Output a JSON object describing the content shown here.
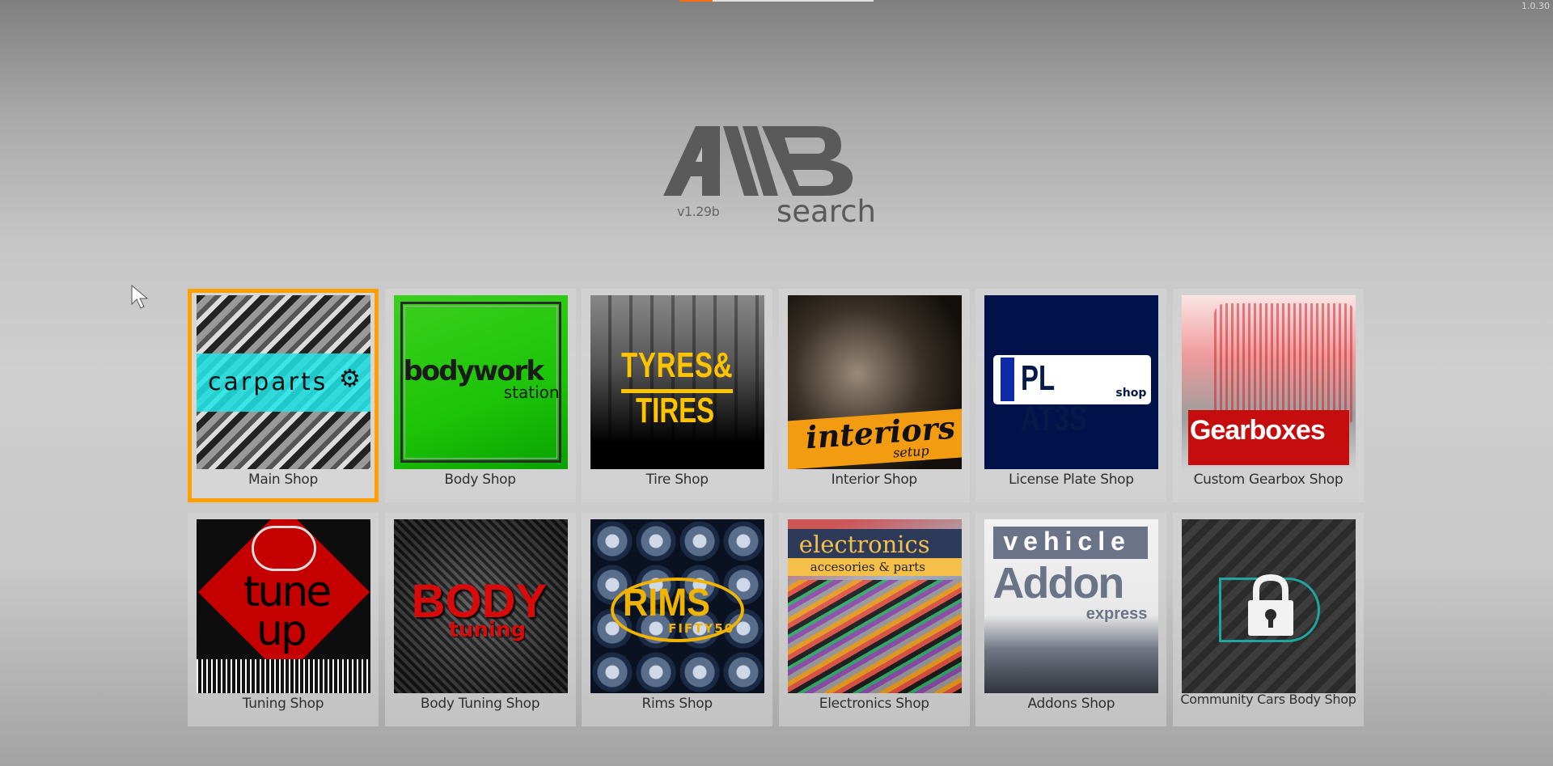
{
  "top_bar": {
    "loading_progress_fraction": 0.17,
    "build_version": "1.0.30",
    "accent_color": "#ff6a13"
  },
  "logo": {
    "brand": "AMB",
    "subtitle": "search",
    "version": "v1.29b",
    "color": "#5a5a5a"
  },
  "selection_color": "#ffa000",
  "shops": [
    {
      "label": "Main Shop",
      "art_text": "carparts",
      "selected": true
    },
    {
      "label": "Body Shop",
      "art_text": "bodywork",
      "art_sub": "station"
    },
    {
      "label": "Tire Shop",
      "art_text": "TYRES&",
      "art_sub": "TIRES"
    },
    {
      "label": "Interior Shop",
      "art_text": "interiors",
      "art_sub": "setup"
    },
    {
      "label": "License Plate Shop",
      "art_text": "PL AT3S",
      "art_sub": "shop"
    },
    {
      "label": "Custom Gearbox Shop",
      "art_text": "Gearboxes"
    },
    {
      "label": "Tuning Shop",
      "art_text": "tune",
      "art_sub": "up"
    },
    {
      "label": "Body Tuning Shop",
      "art_text": "BODY",
      "art_sub": "tuning"
    },
    {
      "label": "Rims Shop",
      "art_text": "RIMS",
      "art_sub": "FIFTY50"
    },
    {
      "label": "Electronics Shop",
      "art_text": "electronics",
      "art_sub": "accesories & parts"
    },
    {
      "label": "Addons Shop",
      "art_top": "vehicle",
      "art_text": "Addon",
      "art_sub": "express"
    },
    {
      "label": "Community Cars Body Shop",
      "locked": true,
      "icon": "lock-icon"
    }
  ]
}
